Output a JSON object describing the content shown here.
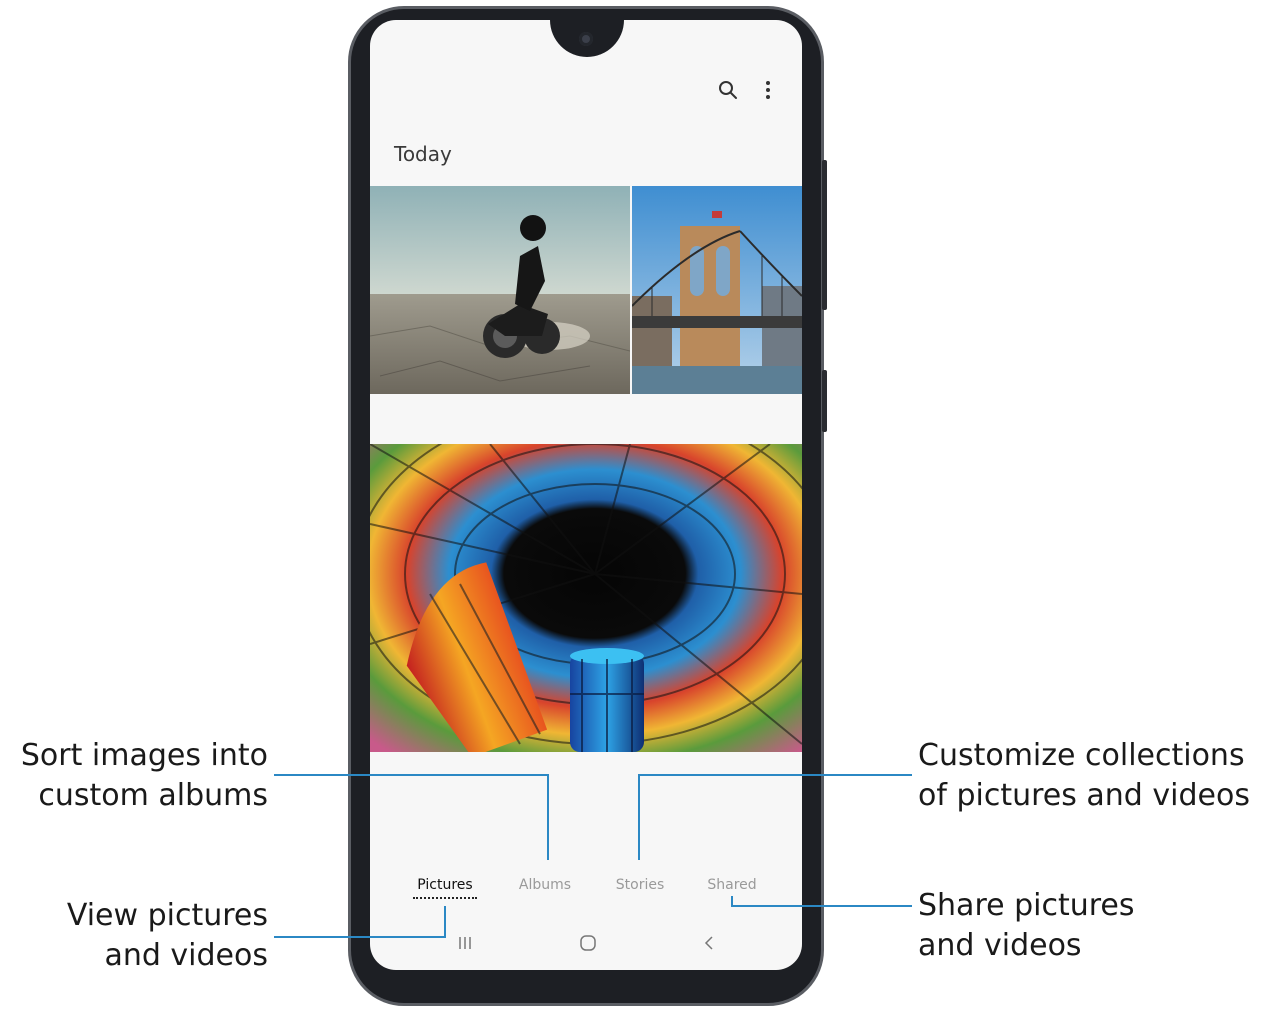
{
  "gallery": {
    "section_title": "Today",
    "toolbar": {
      "search_icon": "search-icon",
      "more_icon": "more-options-icon"
    },
    "photos": [
      {
        "name": "motorcycle-rider-desert",
        "description_icon": "photo"
      },
      {
        "name": "brooklyn-bridge",
        "description_icon": "photo"
      },
      {
        "name": "stained-glass-dome",
        "description_icon": "photo"
      }
    ],
    "tabs": [
      {
        "label": "Pictures",
        "active": true
      },
      {
        "label": "Albums",
        "active": false
      },
      {
        "label": "Stories",
        "active": false
      },
      {
        "label": "Shared",
        "active": false
      }
    ],
    "system_nav": {
      "recent": "recent-apps-icon",
      "home": "home-icon",
      "back": "back-icon"
    }
  },
  "callouts": {
    "albums": {
      "line1": "Sort images into",
      "line2": "custom albums"
    },
    "pictures": {
      "line1": "View pictures",
      "line2": "and videos"
    },
    "stories": {
      "line1": "Customize collections",
      "line2": "of pictures and videos"
    },
    "shared": {
      "line1": "Share pictures",
      "line2": "and videos"
    }
  },
  "colors": {
    "accent_line": "#2b88c4",
    "frame": "#1d1f24",
    "screen_bg": "#f7f7f7"
  }
}
